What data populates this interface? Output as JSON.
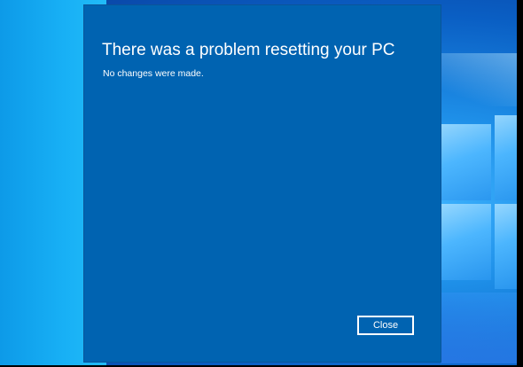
{
  "dialog": {
    "title": "There was a problem resetting your PC",
    "message": "No changes were made.",
    "close_label": "Close"
  },
  "colors": {
    "dialog_background": "#0063b1",
    "text": "#ffffff",
    "desktop_accent": "#1e8fe8"
  },
  "icons": {
    "wallpaper_logo": "windows-logo-icon"
  }
}
